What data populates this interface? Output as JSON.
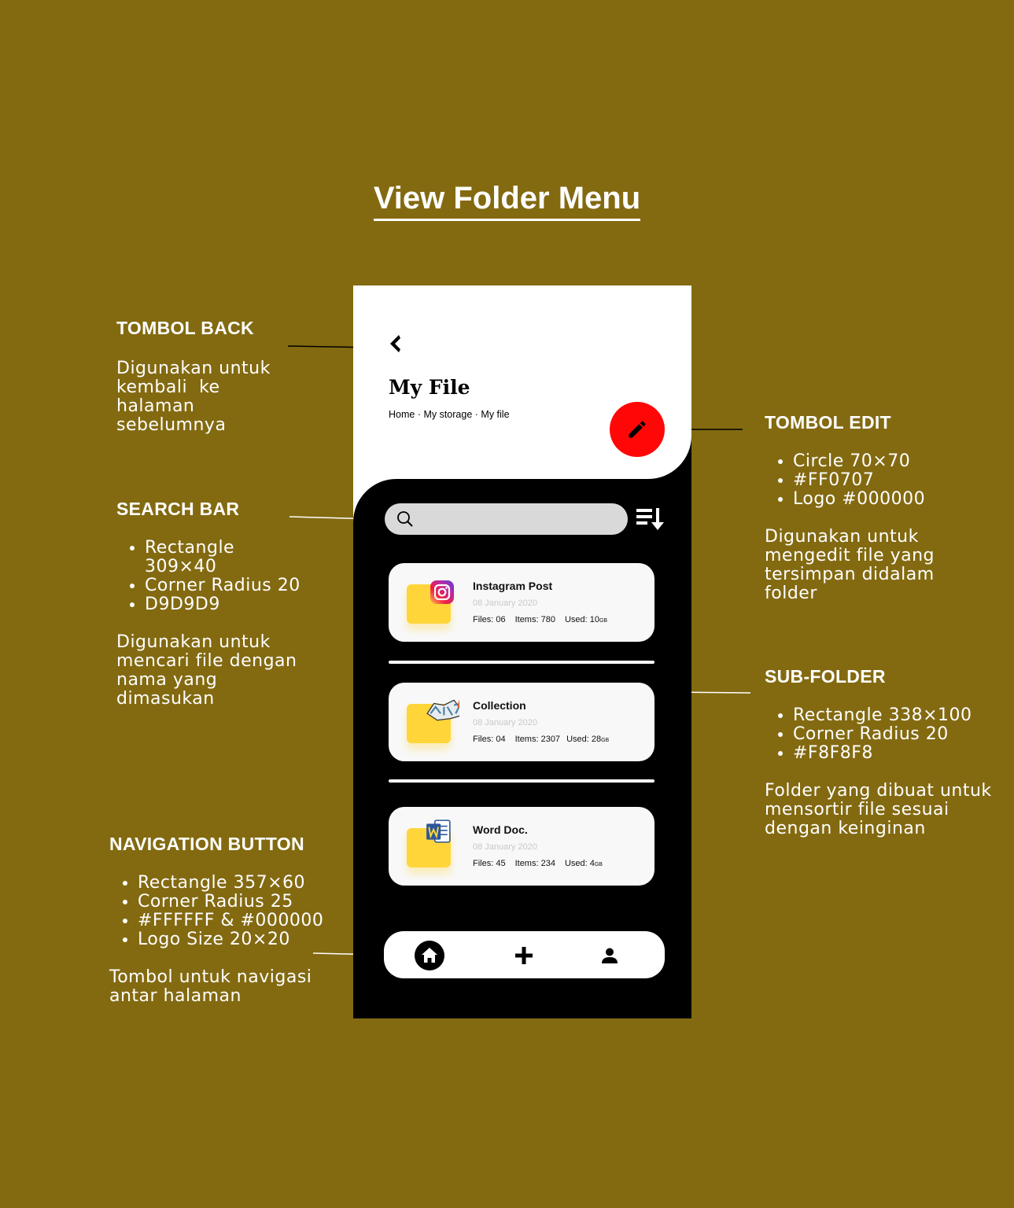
{
  "title": "View Folder Menu",
  "annotations": {
    "back": {
      "heading": "TOMBOL BACK",
      "desc": [
        "Digunakan untuk",
        "kembali  ke",
        "halaman",
        "sebelumnya"
      ]
    },
    "search": {
      "heading": "SEARCH BAR",
      "bullets": [
        "Rectangle 309×40",
        "Corner Radius 20",
        "D9D9D9"
      ],
      "desc": [
        "Digunakan untuk",
        "mencari file dengan",
        "nama yang",
        "dimasukan"
      ]
    },
    "nav": {
      "heading": "NAVIGATION BUTTON",
      "bullets": [
        "Rectangle 357×60",
        "Corner Radius 25",
        "#FFFFFF & #000000",
        "Logo Size 20×20"
      ],
      "desc": [
        "Tombol untuk navigasi",
        "antar halaman"
      ]
    },
    "edit": {
      "heading": "TOMBOL EDIT",
      "bullets": [
        "Circle 70×70",
        "#FF0707",
        "Logo #000000"
      ],
      "desc": [
        "Digunakan untuk",
        "mengedit file yang",
        "tersimpan didalam",
        "folder"
      ]
    },
    "subfolder": {
      "heading": "SUB-FOLDER",
      "bullets": [
        "Rectangle 338×100",
        "Corner Radius 20",
        "#F8F8F8"
      ],
      "desc": [
        "Folder yang dibuat untuk",
        "mensortir file sesuai",
        "dengan keinginan"
      ]
    }
  },
  "phone": {
    "header_title": "My File",
    "breadcrumb": [
      "Home",
      "My storage",
      "My file"
    ],
    "breadcrumb_sep": " · ",
    "search_placeholder": "",
    "folders": [
      {
        "name": "Instagram Post",
        "date": "08 January 2020",
        "files": "Files: 06",
        "items": "Items: 780",
        "used": "Used: 10",
        "unit": "GB",
        "icon": "instagram-icon"
      },
      {
        "name": "Collection",
        "date": "08 January 2020",
        "files": "Files: 04",
        "items": "Items: 2307",
        "used": "Used: 28",
        "unit": "GB",
        "icon": "sticker-icon"
      },
      {
        "name": "Word Doc.",
        "date": "08 January 2020",
        "files": "Files: 45",
        "items": "Items: 234",
        "used": "Used: 4",
        "unit": "GB",
        "icon": "word-icon"
      }
    ],
    "nav_icons": [
      "home-icon",
      "plus-icon",
      "user-icon"
    ]
  },
  "colors": {
    "background": "#836A11",
    "edit_button": "#FF0707",
    "search_bar": "#D9D9D9",
    "card": "#F8F8F8",
    "folder": "#FFD53A"
  }
}
